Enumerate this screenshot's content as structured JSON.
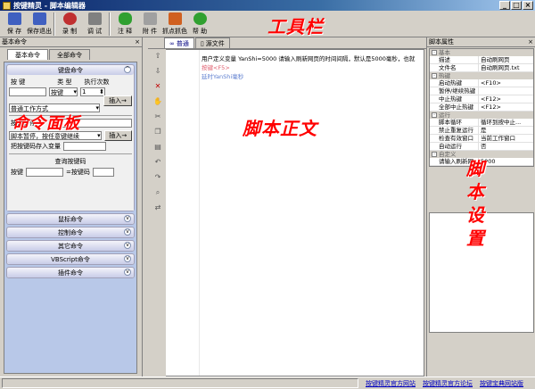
{
  "window": {
    "title": "按键精灵 - 脚本编辑器"
  },
  "toolbar": {
    "buttons": [
      {
        "label": "保 存",
        "icon": "save-icon",
        "color": "#4060c0"
      },
      {
        "label": "保存退出",
        "icon": "save-exit-icon",
        "color": "#4060c0"
      },
      {
        "label": "录 制",
        "icon": "record-icon",
        "color": "#c03030"
      },
      {
        "label": "调 试",
        "icon": "debug-icon",
        "color": "#808080"
      },
      {
        "label": "注 释",
        "icon": "comment-icon",
        "color": "#30a030"
      },
      {
        "label": "附 件",
        "icon": "attachment-icon",
        "color": "#a0a0a0"
      },
      {
        "label": "抓点抓色",
        "icon": "color-picker-icon",
        "color": "#d06020"
      },
      {
        "label": "帮 助",
        "icon": "help-icon",
        "color": "#30a030"
      }
    ],
    "annotation": "工具栏"
  },
  "left": {
    "header": "基本命令",
    "tabs": [
      "基本命令",
      "全部命令"
    ],
    "keyboard": {
      "title": "键盘命令",
      "col_key": "按 键",
      "col_type": "类 型",
      "col_times": "执行次数",
      "type_value": "按键",
      "times_value": "1",
      "insert_label": "插入→",
      "work_mode": "普通工作方式",
      "pause_key_label": "按键暂停",
      "pause_mode": "脚本暂停，按任意键继续",
      "insert2_label": "插入→",
      "store_label": "把按键码存入变量",
      "query_title": "查询按键码",
      "query_key": "按键",
      "query_result": "=按键码"
    },
    "sections": [
      "鼠标命令",
      "控制命令",
      "其它命令",
      "VBScript命令",
      "插件命令"
    ],
    "annotation": "命令面板"
  },
  "editor": {
    "tabs": [
      "普通",
      "源文件"
    ],
    "lines": [
      "用户定义变量 YanShi=5000 请输入刷新网页的时间间隔，默认是5000毫秒，也就",
      "按键<F5>",
      "延时YanShi毫秒"
    ],
    "annotation": "脚本正文"
  },
  "right": {
    "header": "脚本属性",
    "groups": [
      {
        "name": "基本",
        "rows": [
          [
            "描述",
            "自动刷网页"
          ],
          [
            "文件名",
            "自动刷网页.txt"
          ]
        ]
      },
      {
        "name": "热键",
        "rows": [
          [
            "启动热键",
            "<F10>"
          ],
          [
            "暂停/继续热键",
            ""
          ],
          [
            "中止热键",
            "<F12>"
          ],
          [
            "全部中止热键",
            "<F12>"
          ]
        ]
      },
      {
        "name": "运行",
        "rows": [
          [
            "脚本循环",
            "循环到按中止..."
          ],
          [
            "禁止重复运行",
            "是"
          ],
          [
            "检查有效窗口",
            "当前工作窗口"
          ],
          [
            "自动运行",
            "否"
          ]
        ]
      },
      {
        "name": "自定义",
        "rows": [
          [
            "请输入刷新网",
            "5000"
          ]
        ]
      }
    ],
    "annotation": "脚本设置"
  },
  "status": {
    "links": [
      "按键精灵官方网站",
      "按键精灵官方论坛",
      "按键宝典网站版"
    ]
  }
}
